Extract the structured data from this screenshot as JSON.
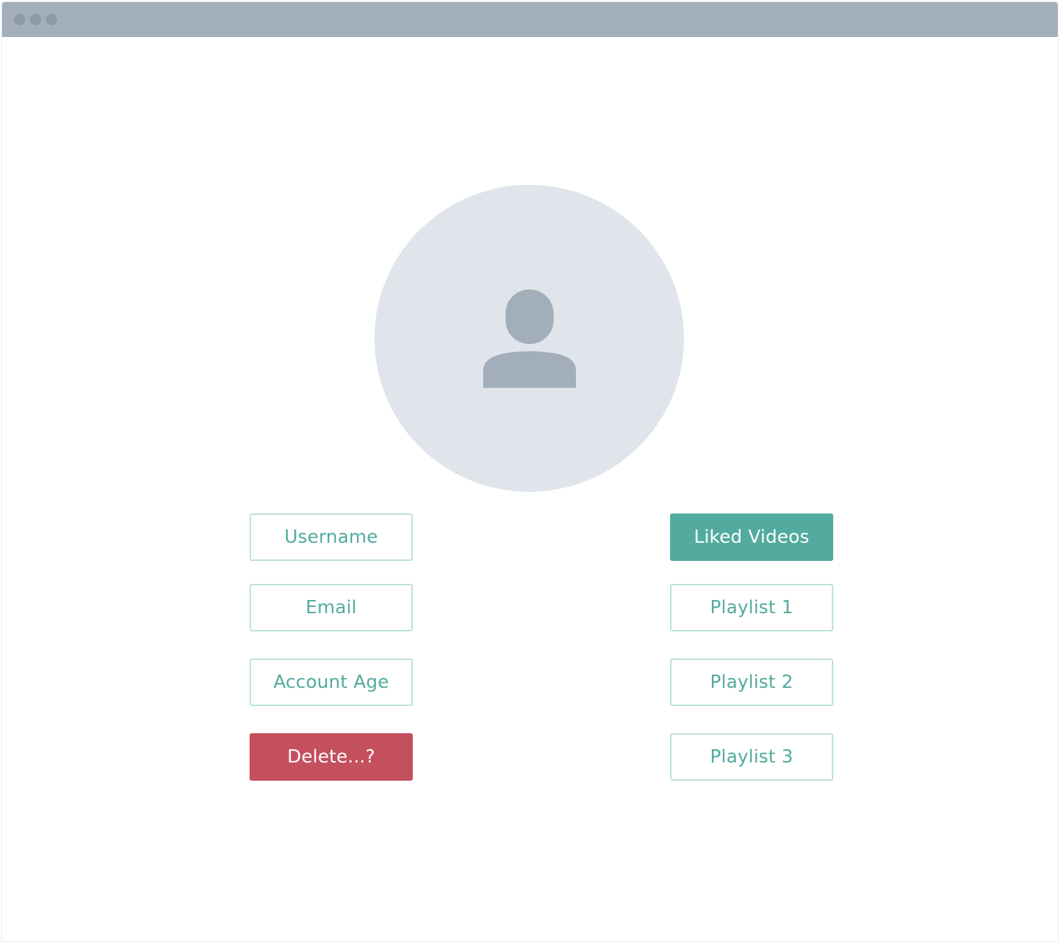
{
  "window": {
    "titlebar_dots": [
      "dot",
      "dot",
      "dot"
    ]
  },
  "profile": {
    "avatar_icon": "user-silhouette-icon"
  },
  "account_buttons": {
    "username": "Username",
    "email": "Email",
    "account_age": "Account Age",
    "delete": "Delete...?"
  },
  "library_buttons": {
    "liked_videos": "Liked Videos",
    "playlist_1": "Playlist 1",
    "playlist_2": "Playlist 2",
    "playlist_3": "Playlist 3"
  },
  "colors": {
    "accent": "#52ab9e",
    "accent_border": "#b9e0dc",
    "danger": "#c44f5d",
    "titlebar": "#a2aeb9",
    "avatar_bg": "#e0e5eb",
    "avatar_icon": "#a2aeb9"
  }
}
